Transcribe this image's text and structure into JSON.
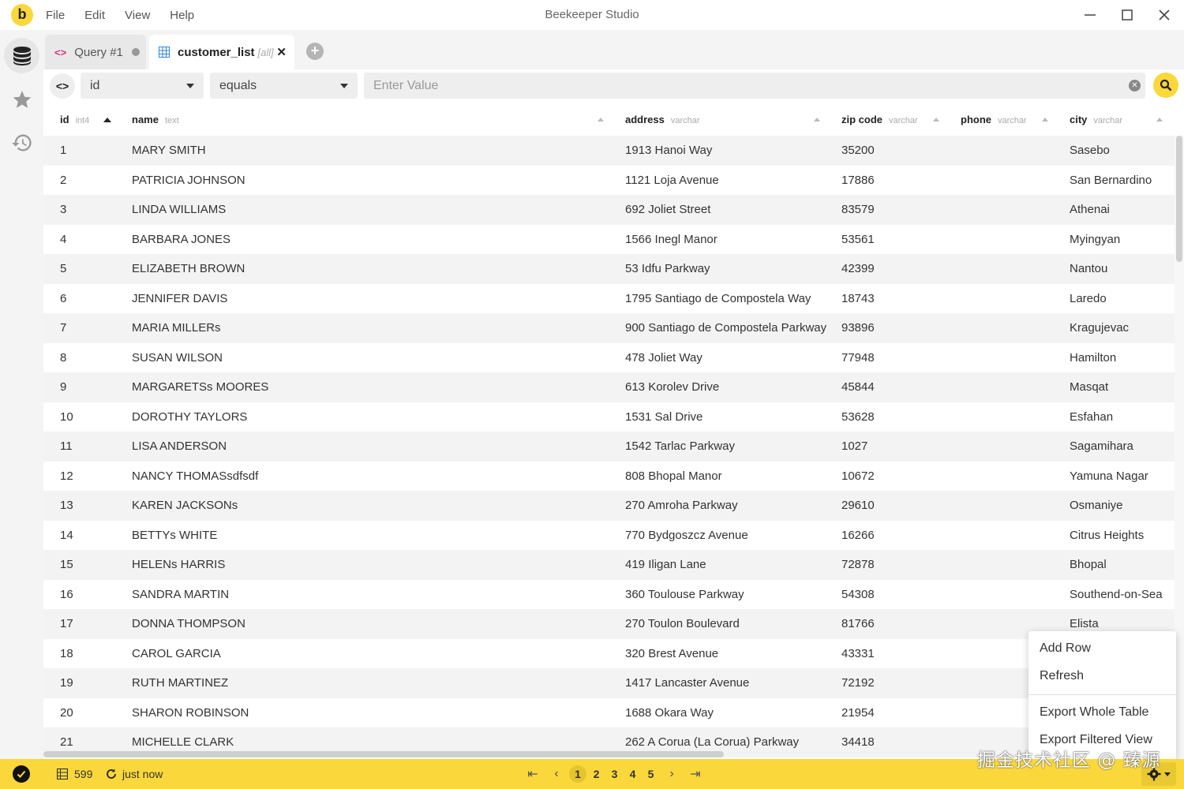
{
  "app": {
    "logo_letter": "b",
    "title": "Beekeeper Studio",
    "menu": [
      "File",
      "Edit",
      "View",
      "Help"
    ]
  },
  "tabs": {
    "query_label": "Query #1",
    "table_label": "customer_list",
    "table_scope": "[all]",
    "close_glyph": "✕"
  },
  "filter": {
    "column": "id",
    "operator": "equals",
    "value_placeholder": "Enter Value"
  },
  "columns": [
    {
      "name": "id",
      "type": "int4"
    },
    {
      "name": "name",
      "type": "text"
    },
    {
      "name": "address",
      "type": "varchar"
    },
    {
      "name": "zip code",
      "type": "varchar"
    },
    {
      "name": "phone",
      "type": "varchar"
    },
    {
      "name": "city",
      "type": "varchar"
    }
  ],
  "rows": [
    [
      "1",
      "MARY SMITH",
      "1913 Hanoi Way",
      "35200",
      "",
      "Sasebo"
    ],
    [
      "2",
      "PATRICIA JOHNSON",
      "1121 Loja Avenue",
      "17886",
      "",
      "San Bernardino"
    ],
    [
      "3",
      "LINDA WILLIAMS",
      "692 Joliet Street",
      "83579",
      "",
      "Athenai"
    ],
    [
      "4",
      "BARBARA JONES",
      "1566 Inegl Manor",
      "53561",
      "",
      "Myingyan"
    ],
    [
      "5",
      "ELIZABETH BROWN",
      "53 Idfu Parkway",
      "42399",
      "",
      "Nantou"
    ],
    [
      "6",
      "JENNIFER DAVIS",
      "1795 Santiago de Compostela Way",
      "18743",
      "",
      "Laredo"
    ],
    [
      "7",
      "MARIA MILLERs",
      "900 Santiago de Compostela Parkway",
      "93896",
      "",
      "Kragujevac"
    ],
    [
      "8",
      "SUSAN WILSON",
      "478 Joliet Way",
      "77948",
      "",
      "Hamilton"
    ],
    [
      "9",
      "MARGARETSs MOORES",
      "613 Korolev Drive",
      "45844",
      "",
      "Masqat"
    ],
    [
      "10",
      "DOROTHY TAYLORS",
      "1531 Sal Drive",
      "53628",
      "",
      "Esfahan"
    ],
    [
      "11",
      "LISA ANDERSON",
      "1542 Tarlac Parkway",
      "1027",
      "",
      "Sagamihara"
    ],
    [
      "12",
      "NANCY THOMASsdfsdf",
      "808 Bhopal Manor",
      "10672",
      "",
      "Yamuna Nagar"
    ],
    [
      "13",
      "KAREN JACKSONs",
      "270 Amroha Parkway",
      "29610",
      "",
      "Osmaniye"
    ],
    [
      "14",
      "BETTYs WHITE",
      "770 Bydgoszcz Avenue",
      "16266",
      "",
      "Citrus Heights"
    ],
    [
      "15",
      "HELENs HARRIS",
      "419 Iligan Lane",
      "72878",
      "",
      "Bhopal"
    ],
    [
      "16",
      "SANDRA MARTIN",
      "360 Toulouse Parkway",
      "54308",
      "",
      "Southend-on-Sea"
    ],
    [
      "17",
      "DONNA THOMPSON",
      "270 Toulon Boulevard",
      "81766",
      "",
      "Elista"
    ],
    [
      "18",
      "CAROL GARCIA",
      "320 Brest Avenue",
      "43331",
      "",
      ""
    ],
    [
      "19",
      "RUTH MARTINEZ",
      "1417 Lancaster Avenue",
      "72192",
      "",
      ""
    ],
    [
      "20",
      "SHARON ROBINSON",
      "1688 Okara Way",
      "21954",
      "",
      ""
    ],
    [
      "21",
      "MICHELLE CLARK",
      "262 A Corua (La Corua) Parkway",
      "34418",
      "",
      ""
    ]
  ],
  "status": {
    "row_count": "599",
    "refreshed": "just now",
    "pages": [
      "1",
      "2",
      "3",
      "4",
      "5"
    ],
    "current_page": "1"
  },
  "context_menu": {
    "items": [
      "Add Row",
      "Refresh",
      "Export Whole Table",
      "Export Filtered View"
    ]
  },
  "watermark": "掘金技术社区 @ 臻源",
  "colors": {
    "accent": "#fad83b",
    "query_icon": "#d63384",
    "table_icon": "#2e86de"
  },
  "icons": {
    "sidebar": [
      "database-icon",
      "star-icon",
      "history-icon"
    ],
    "status": [
      "check-icon",
      "table-icon",
      "refresh-icon",
      "gear-icon"
    ]
  }
}
